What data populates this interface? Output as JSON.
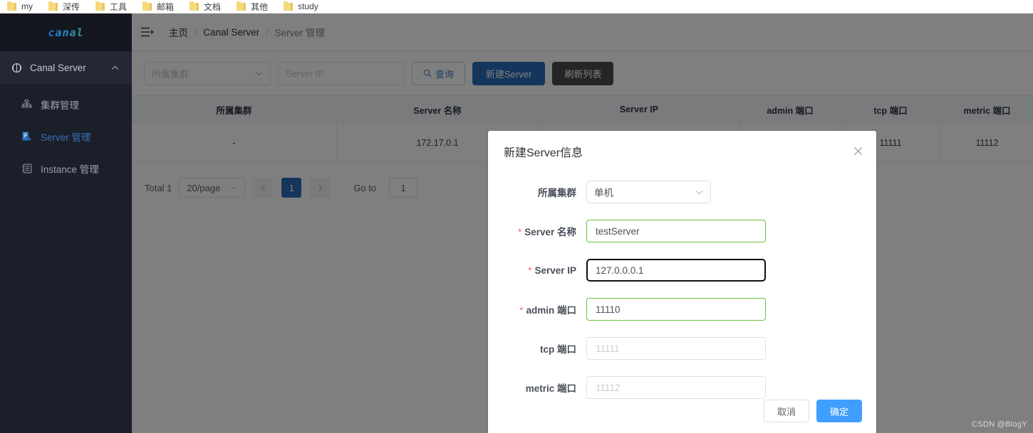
{
  "browser": {
    "bookmarks": [
      {
        "label": "my",
        "icon": "folder-icon"
      },
      {
        "label": "深传",
        "icon": "folder-icon"
      },
      {
        "label": "工具",
        "icon": "folder-icon"
      },
      {
        "label": "邮箱",
        "icon": "folder-icon"
      },
      {
        "label": "文档",
        "icon": "folder-icon"
      },
      {
        "label": "其他",
        "icon": "folder-icon"
      },
      {
        "label": "study",
        "icon": "folder-icon"
      }
    ]
  },
  "sidebar": {
    "logo": "canal",
    "group": {
      "label": "Canal Server",
      "icon": "canal-node-icon",
      "caret": "chevron-up-icon",
      "expanded": true
    },
    "items": [
      {
        "label": "集群管理",
        "icon": "org-chart-icon",
        "active": false
      },
      {
        "label": "Server 管理",
        "icon": "server-doc-icon",
        "active": true
      },
      {
        "label": "Instance 管理",
        "icon": "instance-list-icon",
        "active": false
      }
    ]
  },
  "header": {
    "collapse_icon": "hamburger-collapse-icon",
    "breadcrumb": [
      "主页",
      "Canal Server",
      "Server 管理"
    ],
    "separator": "/"
  },
  "toolbar": {
    "cluster_select_placeholder": "所属集群",
    "cluster_select_value": "",
    "server_ip_placeholder": "Server IP",
    "server_ip_value": "",
    "query_label": "查询",
    "query_icon": "search-icon",
    "new_server_label": "新建Server",
    "refresh_label": "刷新列表",
    "accent_blue": "#2b6cb8",
    "refresh_gray": "#4a4a4a"
  },
  "table": {
    "columns": [
      "所属集群",
      "Server 名称",
      "Server IP",
      "admin 端口",
      "tcp 端口",
      "metric 端口"
    ],
    "rows": [
      {
        "cluster": "-",
        "server_name": "172.17.0.1",
        "server_ip": "",
        "admin_port": "",
        "tcp_port": "11111",
        "metric_port": "11112"
      }
    ]
  },
  "pagination": {
    "total_label": "Total 1",
    "page_size": "20/page",
    "prev_icon": "chevron-left-icon",
    "next_icon": "chevron-right-icon",
    "pages": [
      "1"
    ],
    "current_page": "1",
    "goto_label": "Go to",
    "goto_value": "1"
  },
  "modal": {
    "title": "新建Server信息",
    "close_icon": "close-icon",
    "fields": [
      {
        "label": "所属集群",
        "required": false,
        "type": "select",
        "value": "单机",
        "placeholder": "",
        "state": "normal",
        "caret": "chevron-down-icon"
      },
      {
        "label": "Server 名称",
        "required": true,
        "type": "input",
        "value": "testServer",
        "placeholder": "",
        "state": "valid"
      },
      {
        "label": "Server IP",
        "required": true,
        "type": "input",
        "value": "127.0.0.0.1",
        "placeholder": "",
        "state": "valid-focused"
      },
      {
        "label": "admin 端口",
        "required": true,
        "type": "input",
        "value": "11110",
        "placeholder": "",
        "state": "valid"
      },
      {
        "label": "tcp 端口",
        "required": false,
        "type": "input",
        "value": "",
        "placeholder": "11111",
        "state": "normal"
      },
      {
        "label": "metric 端口",
        "required": false,
        "type": "input",
        "value": "",
        "placeholder": "11112",
        "state": "normal"
      }
    ],
    "required_marker": "*",
    "cancel_label": "取消",
    "confirm_label": "确定",
    "confirm_color": "#409eff",
    "valid_border_color": "#67c23a"
  },
  "watermark": "CSDN @BlogY"
}
